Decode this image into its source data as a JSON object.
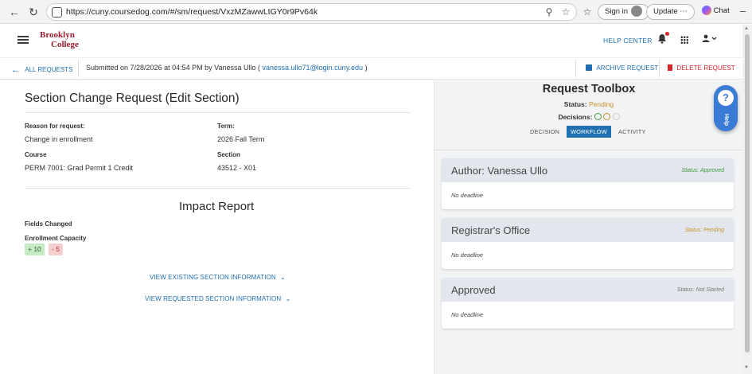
{
  "browser": {
    "url": "https://cuny.coursedog.com/#/sm/request/VxzMZawwLtGY0r9Pv64k",
    "sign_in": "Sign in",
    "update": "Update",
    "chat": "Chat"
  },
  "header": {
    "logo_line1": "Brooklyn",
    "logo_line2": "College",
    "help_center": "HELP CENTER"
  },
  "subheader": {
    "back": "ALL REQUESTS",
    "submitted_prefix": "Submitted on 7/28/2026 at 04:54 PM by Vanessa Ullo (",
    "email": "vanessa.ullo71@login.cuny.edu",
    "submitted_suffix": ")",
    "archive": "ARCHIVE REQUEST",
    "delete": "DELETE REQUEST"
  },
  "form": {
    "title": "Section Change Request (Edit Section)",
    "reason_label": "Reason for request:",
    "reason_value": "Change in enrollment",
    "term_label": "Term:",
    "term_value": "2026 Fall Term",
    "course_label": "Course",
    "course_value": "PERM 7001: Grad Permit 1 Credit",
    "section_label": "Section",
    "section_value": "43512 - X01"
  },
  "impact": {
    "title": "Impact Report",
    "fields_changed": "Fields Changed",
    "field_name": "Enrollment Capacity",
    "added": "+ 10",
    "removed": "- 5",
    "view_existing": "VIEW EXISTING SECTION INFORMATION",
    "view_requested": "VIEW REQUESTED SECTION INFORMATION"
  },
  "toolbox": {
    "title": "Request Toolbox",
    "status_label": "Status:",
    "status_value": "Pending",
    "decisions_label": "Decisions:",
    "tabs": [
      "DECISION",
      "WORKFLOW",
      "ACTIVITY"
    ],
    "help_label": "Help",
    "colors": {
      "pending": "#c8932a",
      "approved": "#3c9a3c",
      "not_started": "#777777",
      "accent": "#1f6fb2",
      "delete": "#d8232a"
    }
  },
  "workflow": [
    {
      "name": "Author: Vanessa Ullo",
      "status": "Status: Approved",
      "deadline": "No deadline"
    },
    {
      "name": "Registrar's Office",
      "status": "Status: Pending",
      "deadline": "No deadline"
    },
    {
      "name": "Approved",
      "status": "Status: Not Started",
      "deadline": "No deadline"
    }
  ]
}
